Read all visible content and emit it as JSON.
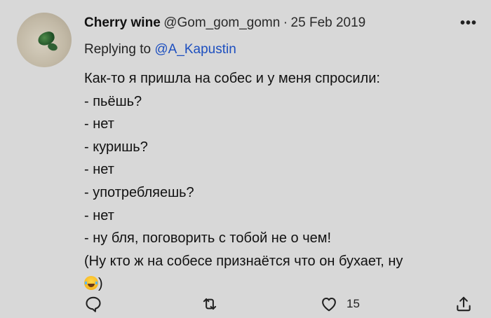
{
  "tweet": {
    "author_name": "Cherry wine",
    "author_handle": "@Gom_gom_gomn",
    "separator": "·",
    "date": "25 Feb 2019",
    "more_label": "•••",
    "replying_prefix": "Replying to",
    "replying_mention": "@A_Kapustin",
    "lines": [
      "Как-то я пришла на собес и у меня спросили:",
      "- пьёшь?",
      "- нет",
      "- куришь?",
      "- нет",
      "- употребляешь?",
      "- нет",
      "- ну бля, поговорить с тобой не о чем!",
      "(Ну кто ж на собесе признаётся что он бухает, ну"
    ],
    "last_line_tail": ")",
    "emoji": "face-with-tears-of-joy",
    "likes": "15"
  },
  "icons": {
    "reply": "reply-icon",
    "retweet": "retweet-icon",
    "like": "heart-icon",
    "share": "share-icon"
  },
  "colors": {
    "background": "#d8d8d8",
    "text": "#111111",
    "mention": "#1d4fbf"
  }
}
